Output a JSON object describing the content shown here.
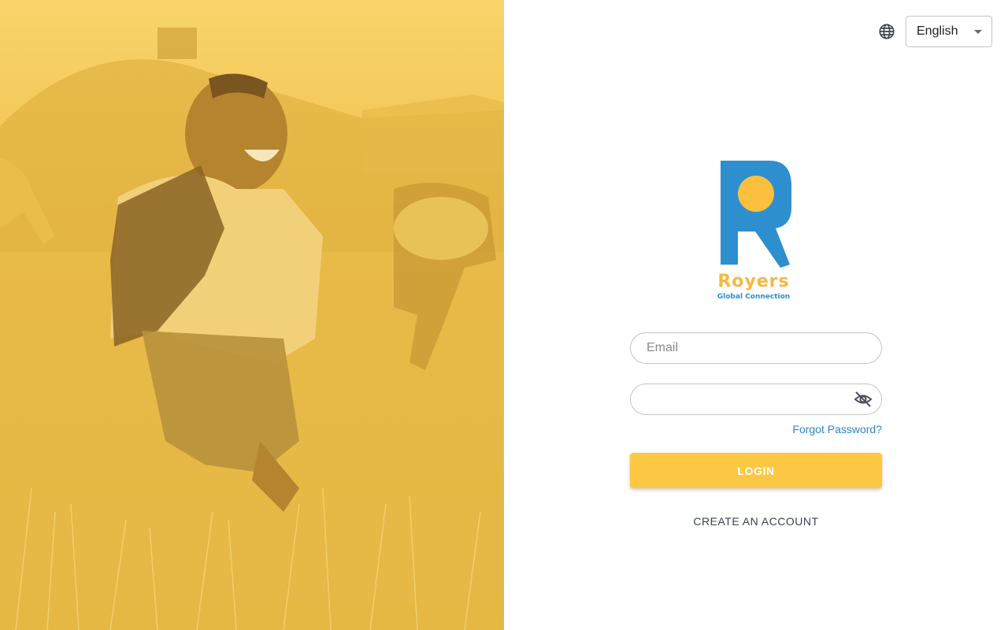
{
  "language": {
    "selected": "English",
    "icon": "globe-icon",
    "dropdown_icon": "caret-down-icon"
  },
  "logo": {
    "name": "Royers",
    "tagline": "Global Connection"
  },
  "form": {
    "email_placeholder": "Email",
    "password_value": "",
    "password_toggle_icon": "visibility-off-icon",
    "forgot_label": "Forgot Password?",
    "login_label": "LOGIN",
    "create_account_label": "CREATE AN ACCOUNT"
  },
  "colors": {
    "brand_yellow": "#fcc844",
    "brand_blue": "#2e8fcf",
    "link_blue": "#2f87c9",
    "hero_tint": "#f2c54e"
  },
  "hero": {
    "image": "children-running-in-field-photo"
  }
}
